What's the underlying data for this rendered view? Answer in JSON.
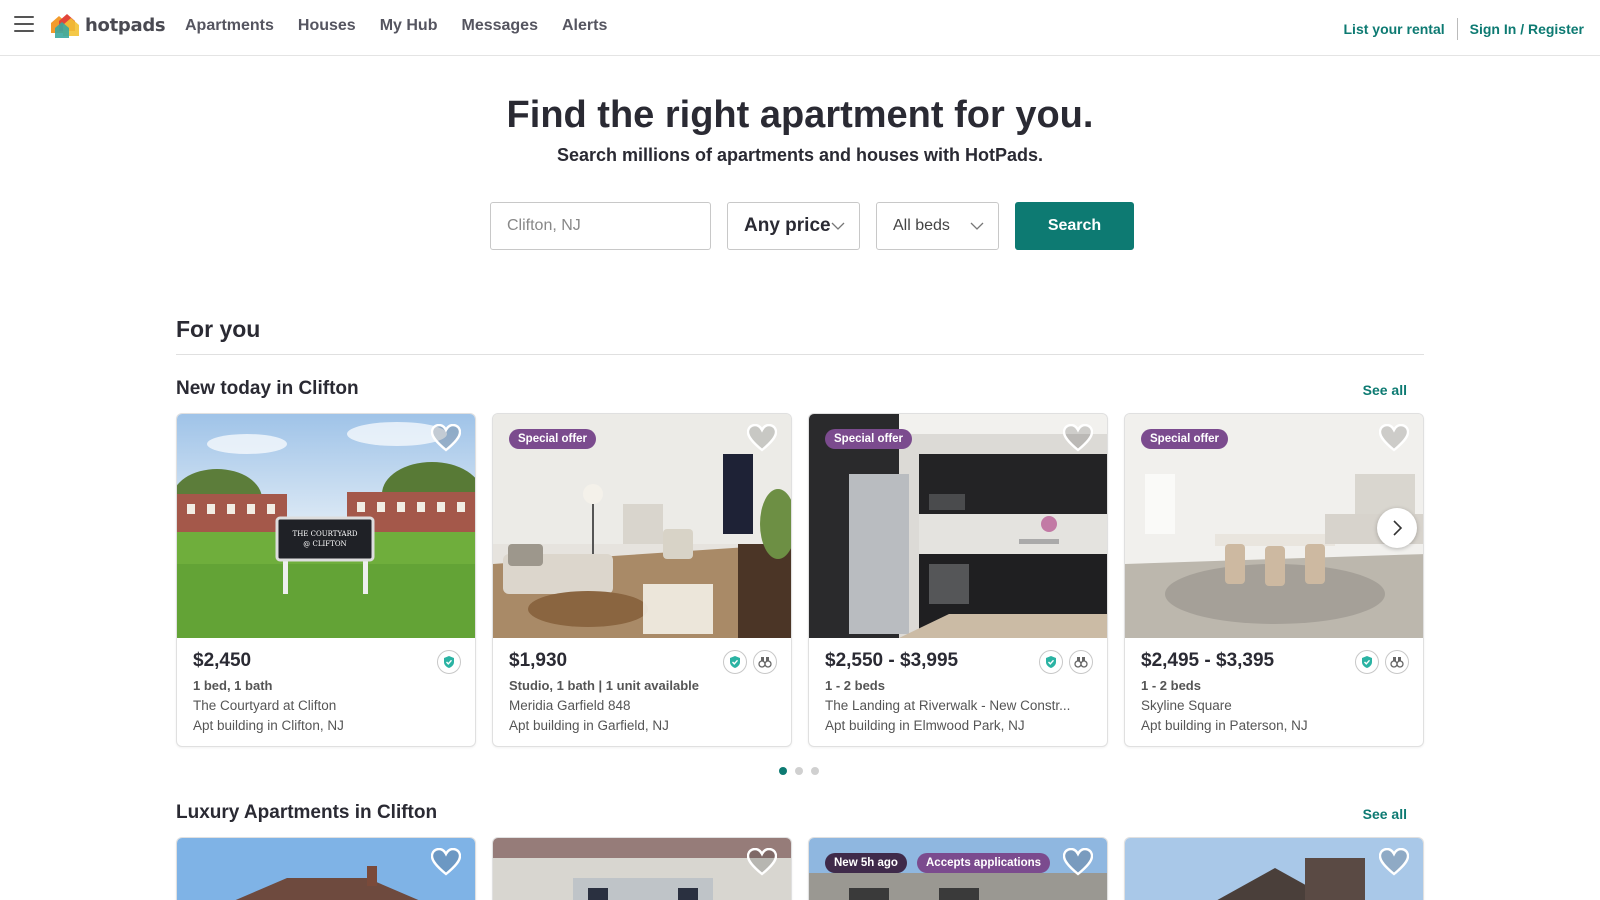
{
  "header": {
    "logo_text": "hotpads",
    "nav": [
      "Apartments",
      "Houses",
      "My Hub",
      "Messages",
      "Alerts"
    ],
    "list_rental": "List your rental",
    "sign_in": "Sign In / Register"
  },
  "hero": {
    "title": "Find the right apartment for you.",
    "subtitle": "Search millions of apartments and houses with HotPads."
  },
  "search": {
    "location_placeholder": "Clifton, NJ",
    "price": "Any price",
    "beds": "All beds",
    "button": "Search"
  },
  "for_you": {
    "title": "For you"
  },
  "new_today": {
    "title": "New today in Clifton",
    "see_all": "See all",
    "cards": [
      {
        "price": "$2,450",
        "beds": "1 bed, 1 bath",
        "name": "The Courtyard at Clifton",
        "type": "Apt building in Clifton, NJ",
        "pill": "",
        "sign_line1": "THE COURTYARD",
        "sign_line2": "@ CLIFTON"
      },
      {
        "price": "$1,930",
        "beds": "Studio, 1 bath | 1 unit available",
        "name": "Meridia Garfield 848",
        "type": "Apt building in Garfield, NJ",
        "pill": "Special offer"
      },
      {
        "price": "$2,550 - $3,995",
        "beds": "1 - 2 beds",
        "name": "The Landing at Riverwalk - New Constr...",
        "type": "Apt building in Elmwood Park, NJ",
        "pill": "Special offer"
      },
      {
        "price": "$2,495 - $3,395",
        "beds": "1 - 2 beds",
        "name": "Skyline Square",
        "type": "Apt building in Paterson, NJ",
        "pill": "Special offer"
      }
    ]
  },
  "carousel_pages": 3,
  "carousel_active": 1,
  "luxury": {
    "title": "Luxury Apartments in Clifton",
    "see_all": "See all",
    "card3_pill1": "New 5h ago",
    "card3_pill2": "Accepts applications"
  },
  "colors": {
    "brand": "#0d7a72",
    "pill": "#7b4b8e",
    "text": "#2a2a33"
  },
  "icons": [
    "menu-icon",
    "heart-icon",
    "verified-shield-icon",
    "tour-binoculars-icon",
    "chevron-down-icon",
    "chevron-right-icon"
  ]
}
